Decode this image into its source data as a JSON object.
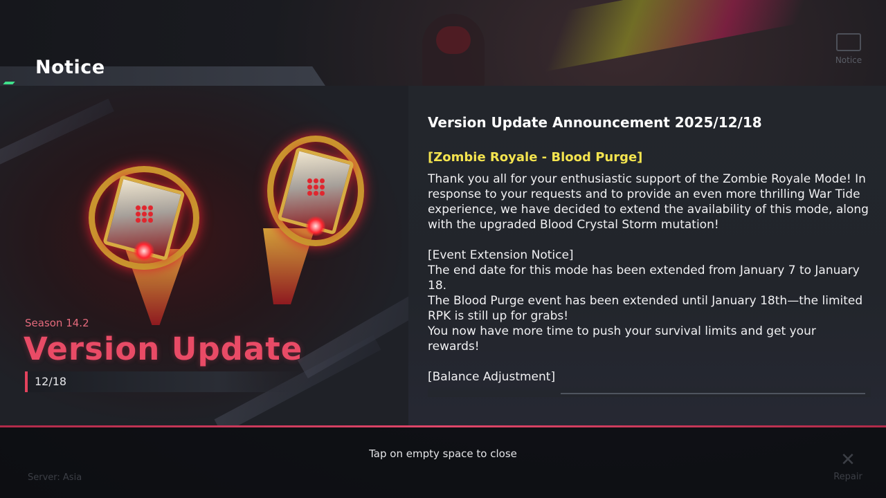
{
  "header": {
    "title": "Notice"
  },
  "top_right": {
    "notice_label": "Notice"
  },
  "banner": {
    "season": "Season 14.2",
    "title": "Version Update",
    "date": "12/18"
  },
  "announcement": {
    "title": "Version Update Announcement 2025/12/18",
    "section_title": "[Zombie Royale - Blood Purge]",
    "intro": "Thank you all for your enthusiastic support of the Zombie Royale Mode! In response to your requests and to provide an even more thrilling War Tide experience, we have decided to extend the availability of this mode, along with the upgraded Blood Crystal Storm mutation!",
    "notice_heading": "[Event Extension Notice]",
    "line1": "The end date for this mode has been extended from January 7 to January 18.",
    "line2": "The Blood Purge event has been extended until January 18th—the limited RPK is still up for grabs!",
    "line3": "You now have more time to push your survival limits and get your rewards!",
    "next_heading": "[Balance Adjustment]"
  },
  "footer": {
    "close_hint": "Tap on empty space to close",
    "server": "Server: Asia",
    "repair_label": "Repair"
  }
}
